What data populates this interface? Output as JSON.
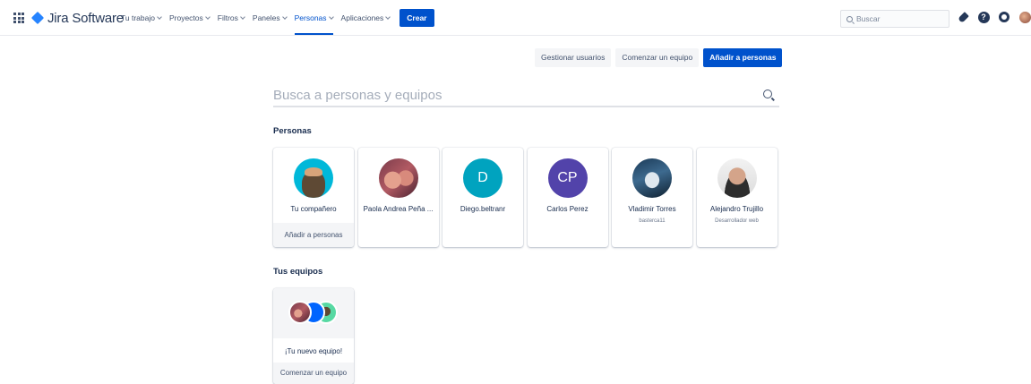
{
  "header": {
    "product_name": "Jira Software",
    "nav": [
      {
        "label": "Tu trabajo",
        "active": false
      },
      {
        "label": "Proyectos",
        "active": false
      },
      {
        "label": "Filtros",
        "active": false
      },
      {
        "label": "Paneles",
        "active": false
      },
      {
        "label": "Personas",
        "active": true
      },
      {
        "label": "Aplicaciones",
        "active": false
      }
    ],
    "create_label": "Crear",
    "search_placeholder": "Buscar",
    "icons": [
      "app-switcher-icon",
      "jira-logo-icon",
      "rocket-icon",
      "help-icon",
      "settings-gear-icon",
      "user-avatar"
    ]
  },
  "actions": {
    "manage_users": "Gestionar usuarios",
    "start_team": "Comenzar un equipo",
    "add_people": "Añadir a personas"
  },
  "search": {
    "placeholder": "Busca a personas y equipos"
  },
  "people_section": {
    "title": "Personas",
    "cards": [
      {
        "name": "Tu compañero",
        "subtitle": "",
        "button": "Añadir a personas"
      },
      {
        "name": "Paola Andrea Peña ...",
        "subtitle": ""
      },
      {
        "name": "Diego.beltranr",
        "subtitle": "",
        "initials": "D"
      },
      {
        "name": "Carlos Perez",
        "subtitle": "",
        "initials": "CP"
      },
      {
        "name": "Vladimir Torres",
        "subtitle": "basterca11"
      },
      {
        "name": "Alejandro Trujillo",
        "subtitle": "Desarrollador web"
      }
    ]
  },
  "teams_section": {
    "title": "Tus equipos",
    "card": {
      "name": "¡Tu nuevo equipo!",
      "button": "Comenzar un equipo"
    }
  },
  "colors": {
    "primary": "#0052cc",
    "text": "#172b4d",
    "subtle_bg": "#f4f5f7"
  }
}
